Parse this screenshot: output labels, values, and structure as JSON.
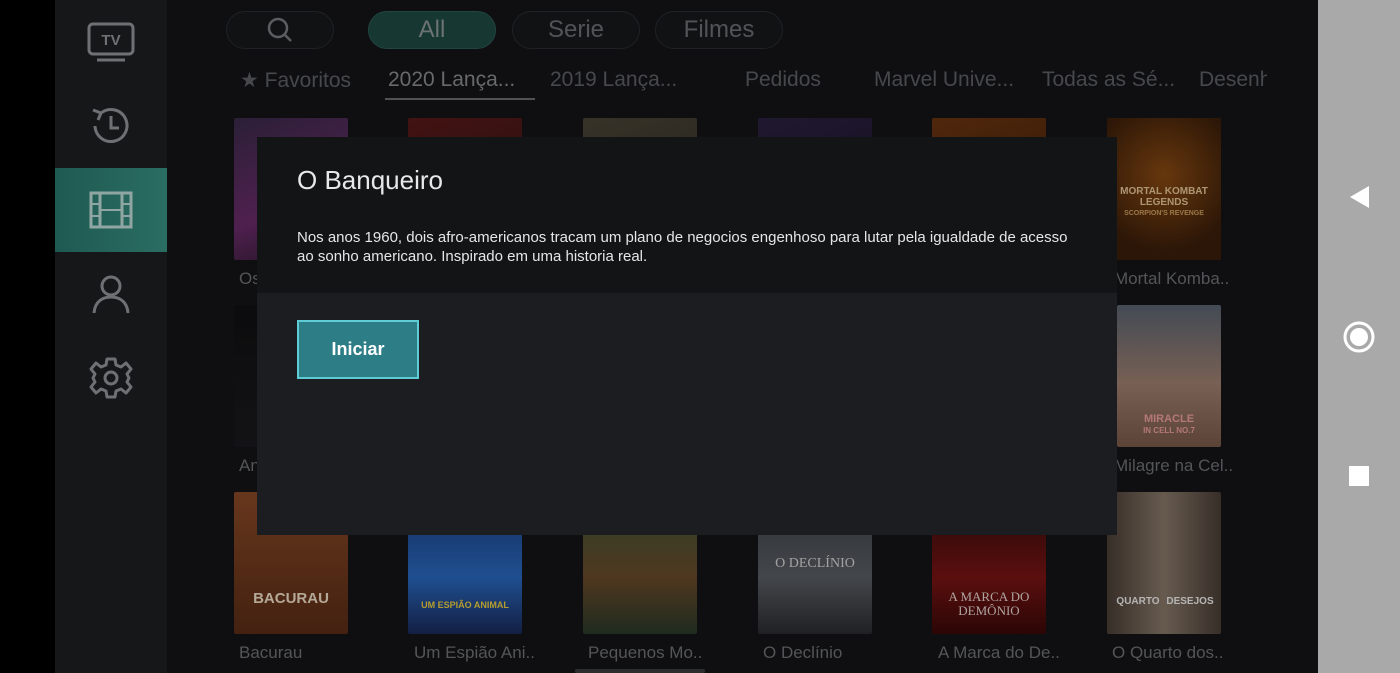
{
  "sidebar": {
    "items": [
      {
        "icon": "tv-icon",
        "text": "TV",
        "active": false
      },
      {
        "icon": "history-icon",
        "active": false
      },
      {
        "icon": "film-icon",
        "active": true
      },
      {
        "icon": "user-icon",
        "active": false
      },
      {
        "icon": "gear-icon",
        "active": false
      }
    ]
  },
  "filters": {
    "search_icon": "search-icon",
    "tabs": [
      {
        "label": "All",
        "active": true
      },
      {
        "label": "Serie",
        "active": false
      },
      {
        "label": "Filmes",
        "active": false
      }
    ]
  },
  "categories": [
    {
      "label": "★ Favoritos"
    },
    {
      "label": "2020 Lança...",
      "active": true
    },
    {
      "label": "2019 Lança..."
    },
    {
      "label": "Pedidos"
    },
    {
      "label": "Marvel Unive..."
    },
    {
      "label": "Todas as Sé..."
    },
    {
      "label": "Desenh"
    }
  ],
  "movies": {
    "row1": [
      {
        "title": "Os"
      },
      {
        "title": ""
      },
      {
        "title": ""
      },
      {
        "title": ""
      },
      {
        "title": ""
      },
      {
        "title": "Mortal Komba..",
        "poster_text": [
          "MORTAL KOMBAT",
          "LEGENDS",
          "SCORPION'S REVENGE"
        ]
      }
    ],
    "row2": [
      {
        "title": "An"
      },
      {
        "title": "Milagre na Cel..",
        "poster_text": [
          "MIRACLE",
          "IN CELL NO.7"
        ]
      }
    ],
    "row3": [
      {
        "title": "Bacurau",
        "poster_text": "BACURAU"
      },
      {
        "title": "Um Espião Ani..",
        "poster_text": "UM ESPIÃO ANIMAL"
      },
      {
        "title": "Pequenos Mo.."
      },
      {
        "title": "O Declínio",
        "poster_text": "O DECLÍNIO"
      },
      {
        "title": "A Marca do De..",
        "poster_text": "A MARCA DO DEMÔNIO"
      },
      {
        "title": "O Quarto dos..",
        "poster_text": [
          "QUARTO",
          "DESEJOS"
        ]
      }
    ]
  },
  "dialog": {
    "title": "O Banqueiro",
    "description": "Nos anos 1960, dois afro-americanos tracam um plano de negocios engenhoso para lutar pela igualdade de acesso ao sonho americano. Inspirado em uma historia real.",
    "start_label": "Iniciar"
  },
  "navbar": {
    "buttons": [
      "back-icon",
      "home-icon",
      "recents-icon"
    ]
  },
  "colors": {
    "accent": "#2c7d86",
    "accent_border": "#5fcbd5",
    "active_tab": "#1f4a44",
    "sidebar_active": "#2a6d62"
  }
}
